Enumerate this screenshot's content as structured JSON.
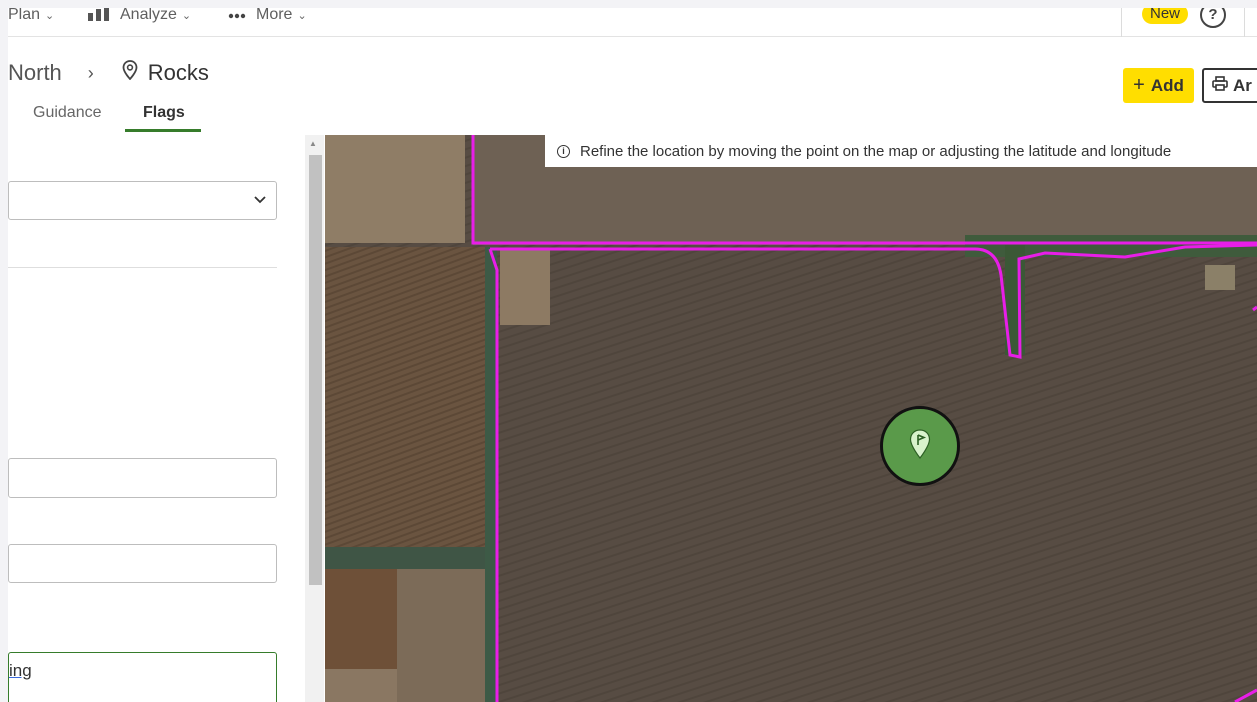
{
  "nav": {
    "plan_label": "Plan",
    "analyze_label": "Analyze",
    "more_label": "More",
    "new_badge": "New",
    "help_glyph": "?"
  },
  "header": {
    "breadcrumb_parent": "North",
    "breadcrumb_sep": "›",
    "breadcrumb_current": "Rocks",
    "tabs": [
      {
        "label": "Guidance",
        "active": false
      },
      {
        "label": "Flags",
        "active": true
      }
    ],
    "add_label": "Add",
    "ar_label": "Ar"
  },
  "panel": {
    "notes_value": "ing"
  },
  "map": {
    "tooltip_text": "Refine the location by moving the point on the map or adjusting the latitude and longitude",
    "boundary_color": "#e81ee8",
    "marker_color": "#5a9a4a"
  },
  "colors": {
    "accent_yellow": "#ffde00",
    "accent_green": "#367c2b"
  },
  "icons": [
    "chevron-down-icon",
    "bar-chart-icon",
    "more-dots-icon",
    "help-icon",
    "location-pin-icon",
    "plus-icon",
    "printer-icon",
    "info-icon",
    "flag-pin-icon"
  ]
}
